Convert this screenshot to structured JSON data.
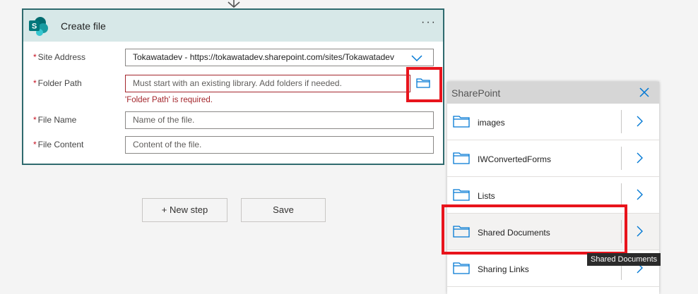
{
  "card": {
    "title": "Create file",
    "more_label": "···",
    "fields": {
      "site_address": {
        "label": "Site Address",
        "value": "Tokawatadev - https://tokawatadev.sharepoint.com/sites/Tokawatadev"
      },
      "folder_path": {
        "label": "Folder Path",
        "placeholder": "Must start with an existing library. Add folders if needed.",
        "error": "'Folder Path' is required."
      },
      "file_name": {
        "label": "File Name",
        "placeholder": "Name of the file."
      },
      "file_content": {
        "label": "File Content",
        "placeholder": "Content of the file."
      }
    },
    "required_marker": "*"
  },
  "actions": {
    "new_step": "+ New step",
    "save": "Save"
  },
  "picker": {
    "title": "SharePoint",
    "items": [
      {
        "label": "images"
      },
      {
        "label": "IWConvertedForms"
      },
      {
        "label": "Lists"
      },
      {
        "label": "Shared Documents"
      },
      {
        "label": "Sharing Links"
      }
    ],
    "tooltip": "Shared Documents"
  },
  "colors": {
    "accent": "#2f6a6e",
    "header": "#d7e8e8",
    "error": "#a4262c",
    "highlight_box": "#e8141c",
    "icon_blue": "#0078d4"
  }
}
